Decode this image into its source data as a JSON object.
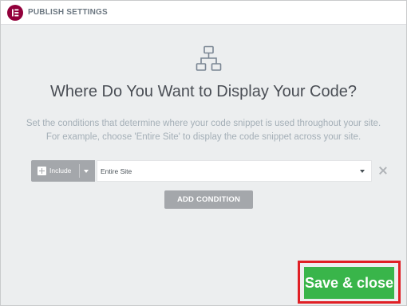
{
  "header": {
    "title": "PUBLISH SETTINGS",
    "logo_icon": "elementor-logo"
  },
  "main": {
    "icon": "sitemap-icon",
    "heading": "Where Do You Want to Display Your Code?",
    "description_line1": "Set the conditions that determine where your code snippet is used throughout your site.",
    "description_line2": "For example, choose 'Entire Site' to display the code snippet across your site."
  },
  "condition": {
    "type_selected": "Include",
    "rule_selected": "Entire Site",
    "remove_icon": "close-icon"
  },
  "actions": {
    "add_condition_label": "ADD CONDITION",
    "save_label": "Save & close"
  },
  "colors": {
    "brand": "#92003b",
    "save_green": "#39b54a",
    "highlight_red": "#e01f25",
    "gray_button": "#a4a7ab",
    "panel_bg": "#eceeef"
  }
}
